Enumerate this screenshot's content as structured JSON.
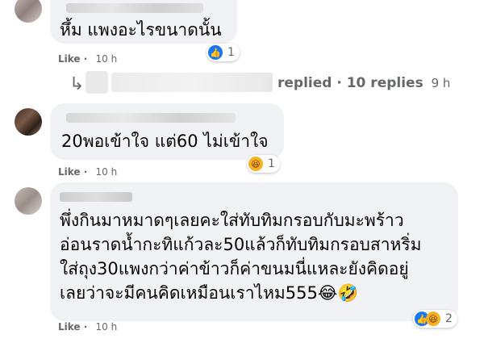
{
  "comments": [
    {
      "text": "หึ้ม แพงอะไรขนาดนั้น",
      "like_label": "Like",
      "time": "10 h",
      "reaction_count": "1",
      "reaction_icons": [
        "like-icon"
      ]
    },
    {
      "text": "20พอเข้าใจ แต่60 ไม่เข้าใจ",
      "like_label": "Like",
      "time": "10 h",
      "reaction_count": "1",
      "reaction_icons": [
        "haha-icon"
      ]
    },
    {
      "text_lines": [
        "พึ่งกินมาหมาดๆเลยคะใส่ทับทิมกรอบกับมะพร้าว",
        "อ่อนราดน้ำกะทิแก้วละ50แล้วก็ทับทิมกรอบสาหริ่ม",
        "ใส่ถุง30แพงกว่าค่าข้าวก็ค่าขนมนี่แหละยังคิดอยู่",
        "เลยว่าจะมีคนคิดเหมือนเราไหม555😂🤣"
      ],
      "like_label": "Like",
      "time": "10 h",
      "reaction_count": "2",
      "reaction_icons": [
        "like-icon",
        "haha-icon"
      ]
    }
  ],
  "reply_summary": {
    "arrow": "↳",
    "text": "replied · 10 replies",
    "time": "9 h"
  },
  "colors": {
    "bubble": "#f0f2f5",
    "meta_text": "#65676b",
    "like_blue": "#1877f2",
    "haha_yellow": "#f7b125"
  }
}
